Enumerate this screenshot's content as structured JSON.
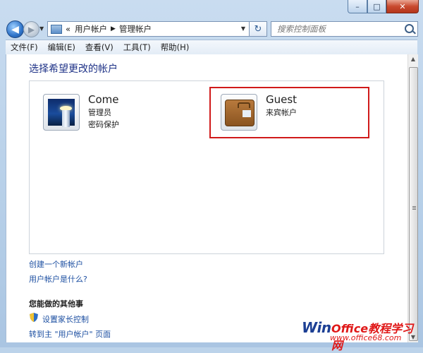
{
  "window": {
    "caption": {
      "minimize": "–",
      "maximize": "□",
      "close": "✕"
    }
  },
  "nav": {
    "back_glyph": "◀",
    "forward_glyph": "▶",
    "recent_glyph": "▼",
    "address": {
      "prefix": "«",
      "crumb1": "用户帐户",
      "separator": "▶",
      "crumb2": "管理帐户"
    },
    "dropdown_glyph": "▼",
    "refresh_glyph": "↻",
    "search_placeholder": "搜索控制面板"
  },
  "menu": [
    "文件(F)",
    "编辑(E)",
    "查看(V)",
    "工具(T)",
    "帮助(H)"
  ],
  "main": {
    "heading": "选择希望更改的帐户",
    "accounts": [
      {
        "name": "Come",
        "type": "管理员",
        "status": "密码保护",
        "icon": "lighthouse-icon"
      },
      {
        "name": "Guest",
        "type": "来宾帐户",
        "status": "",
        "icon": "suitcase-icon"
      }
    ],
    "links": {
      "create": "创建一个新帐户",
      "what_is": "用户帐户是什么?"
    },
    "other_heading": "您能做的其他事",
    "other_links": {
      "parental": "设置家长控制",
      "goto_main": "转到主 \"用户帐户\" 页面"
    }
  },
  "watermark": {
    "brand": "Win",
    "site": "Office教程学习网",
    "url": "www.office68.com"
  },
  "colors": {
    "highlight": "#d01a1a",
    "link": "#1e50a2",
    "heading": "#1e3287"
  }
}
